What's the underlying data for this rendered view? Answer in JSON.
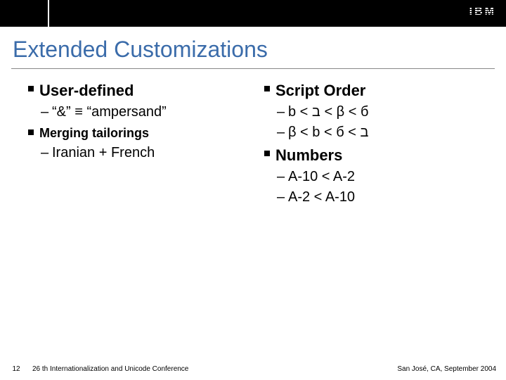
{
  "logo": "IBM",
  "title": "Extended Customizations",
  "left": {
    "h1": "User-defined",
    "s1": "“&” ≡ “ampersand”",
    "h2": "Merging tailorings",
    "s2": "Iranian + French"
  },
  "right": {
    "h1": "Script Order",
    "s1": "b < ב < β < б",
    "s2": "β < b < б < ב",
    "h2": "Numbers",
    "s3": " A-10 < A-2",
    "s4": " A-2 < A-10"
  },
  "footer": {
    "page": "12",
    "title": "26 th Internationalization and Unicode Conference",
    "place": "San José, CA, September 2004"
  }
}
